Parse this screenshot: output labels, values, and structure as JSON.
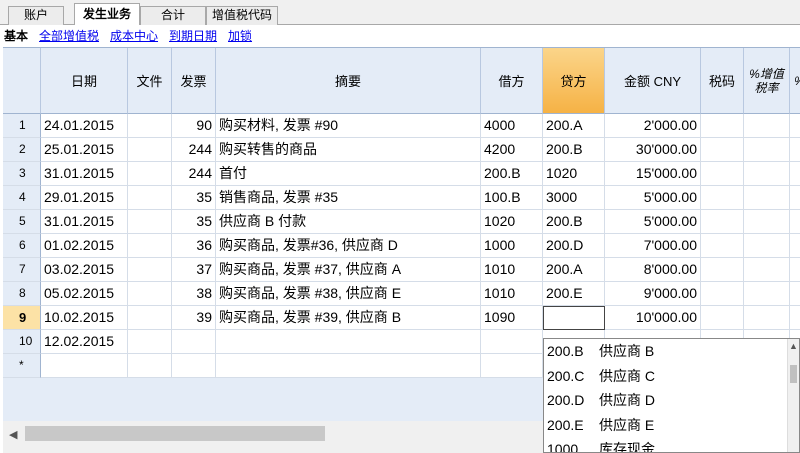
{
  "tabs": [
    "账户",
    "发生业务",
    "合计",
    "增值税代码"
  ],
  "active_tab": 1,
  "subtabs": [
    "基本",
    "全部增值税",
    "成本中心",
    "到期日期",
    "加锁"
  ],
  "columns": [
    "日期",
    "文件",
    "发票",
    "摘要",
    "借方",
    "贷方",
    "金额 CNY",
    "税码",
    "%增值\n税率",
    "%"
  ],
  "rows": [
    {
      "num": "1",
      "date": "24.01.2015",
      "doc": "",
      "invoice": "90",
      "desc": "购买材料, 发票 #90",
      "debit": "4000",
      "credit": "200.A",
      "amount": "2'000.00"
    },
    {
      "num": "2",
      "date": "25.01.2015",
      "doc": "",
      "invoice": "244",
      "desc": "购买转售的商品",
      "debit": "4200",
      "credit": "200.B",
      "amount": "30'000.00"
    },
    {
      "num": "3",
      "date": "31.01.2015",
      "doc": "",
      "invoice": "244",
      "desc": "首付",
      "debit": "200.B",
      "credit": "1020",
      "amount": "15'000.00"
    },
    {
      "num": "4",
      "date": "29.01.2015",
      "doc": "",
      "invoice": "35",
      "desc": "销售商品, 发票 #35",
      "debit": "100.B",
      "credit": "3000",
      "amount": "5'000.00"
    },
    {
      "num": "5",
      "date": "31.01.2015",
      "doc": "",
      "invoice": "35",
      "desc": "供应商 B 付款",
      "debit": "1020",
      "credit": "200.B",
      "amount": "5'000.00"
    },
    {
      "num": "6",
      "date": "01.02.2015",
      "doc": "",
      "invoice": "36",
      "desc": "购买商品, 发票#36,  供应商 D",
      "debit": "1000",
      "credit": "200.D",
      "amount": "7'000.00"
    },
    {
      "num": "7",
      "date": "03.02.2015",
      "doc": "",
      "invoice": "37",
      "desc": "购买商品, 发票 #37, 供应商 A",
      "debit": "1010",
      "credit": "200.A",
      "amount": "8'000.00"
    },
    {
      "num": "8",
      "date": "05.02.2015",
      "doc": "",
      "invoice": "38",
      "desc": "购买商品, 发票 #38, 供应商 E",
      "debit": "1010",
      "credit": "200.E",
      "amount": "9'000.00"
    },
    {
      "num": "9",
      "date": "10.02.2015",
      "doc": "",
      "invoice": "39",
      "desc": "购买商品, 发票 #39, 供应商 B",
      "debit": "1090",
      "credit": "",
      "amount": "10'000.00"
    },
    {
      "num": "10",
      "date": "12.02.2015",
      "doc": "",
      "invoice": "",
      "desc": "",
      "debit": "",
      "credit": "",
      "amount": ""
    },
    {
      "num": "*",
      "date": "",
      "doc": "",
      "invoice": "",
      "desc": "",
      "debit": "",
      "credit": "",
      "amount": ""
    }
  ],
  "current_row": "9",
  "dropdown": [
    {
      "code": "200.B",
      "name": "供应商 B"
    },
    {
      "code": "200.C",
      "name": "供应商 C"
    },
    {
      "code": "200.D",
      "name": "供应商 D"
    },
    {
      "code": "200.E",
      "name": "供应商 E"
    },
    {
      "code": "1000",
      "name": "库存现金"
    }
  ]
}
